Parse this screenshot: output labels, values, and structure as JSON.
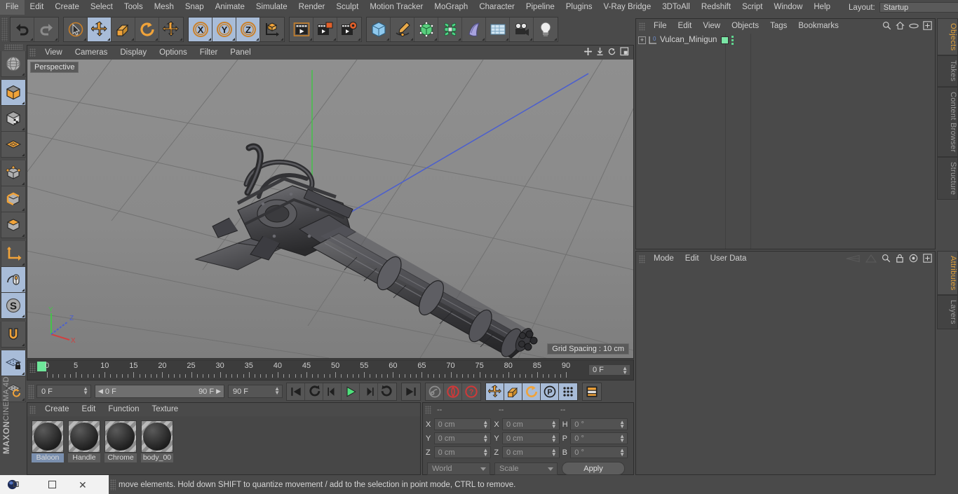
{
  "app": {
    "name": "CINEMA 4D",
    "brand_top": "MAXON",
    "brand_bottom": "CINEMA 4D"
  },
  "menubar": {
    "items": [
      "File",
      "Edit",
      "Create",
      "Select",
      "Tools",
      "Mesh",
      "Snap",
      "Animate",
      "Simulate",
      "Render",
      "Sculpt",
      "Motion Tracker",
      "MoGraph",
      "Character",
      "Pipeline",
      "Plugins",
      "V-Ray Bridge",
      "3DToAll",
      "Redshift",
      "Script",
      "Window",
      "Help"
    ],
    "layout_label": "Layout:",
    "layout_value": "Startup",
    "search_icon": "search-icon"
  },
  "toolbar": {
    "groups": [
      {
        "name": "history",
        "buttons": [
          {
            "icon": "undo-icon",
            "label": "Undo",
            "active": false
          },
          {
            "icon": "redo-icon",
            "label": "Redo",
            "active": false
          }
        ]
      },
      {
        "name": "tools",
        "buttons": [
          {
            "icon": "live-selection-icon",
            "label": "Live Selection",
            "active": false
          },
          {
            "icon": "move-icon",
            "label": "Move",
            "active": true
          },
          {
            "icon": "scale-icon",
            "label": "Scale",
            "active": false
          },
          {
            "icon": "rotate-icon",
            "label": "Rotate",
            "active": false
          },
          {
            "icon": "move-alt-icon",
            "label": "Move Alt",
            "active": false
          }
        ]
      },
      {
        "name": "axis-locks",
        "buttons": [
          {
            "icon": "axis-x-icon",
            "label": "X Axis",
            "active": true
          },
          {
            "icon": "axis-y-icon",
            "label": "Y Axis",
            "active": true
          },
          {
            "icon": "axis-z-icon",
            "label": "Z Axis",
            "active": true
          },
          {
            "icon": "world-coordinates-icon",
            "label": "World / Object Coordinates",
            "active": false
          }
        ]
      },
      {
        "name": "render",
        "buttons": [
          {
            "icon": "render-view-icon",
            "label": "Render View",
            "active": false
          },
          {
            "icon": "render-picture-viewer-icon",
            "label": "Render to Picture Viewer",
            "active": false
          },
          {
            "icon": "render-settings-icon",
            "label": "Edit Render Settings",
            "active": false
          }
        ]
      },
      {
        "name": "objects",
        "buttons": [
          {
            "icon": "cube-primitive-icon",
            "label": "Add Cube Object",
            "active": false
          },
          {
            "icon": "spline-pen-icon",
            "label": "Add Spline Object",
            "active": false
          },
          {
            "icon": "generator-icon",
            "label": "Add Generator Object",
            "active": false
          },
          {
            "icon": "mograph-icon",
            "label": "Add MoGraph Object",
            "active": false
          },
          {
            "icon": "deformer-icon",
            "label": "Add Bend Object",
            "active": false
          },
          {
            "icon": "scene-floor-icon",
            "label": "Add Environment Object",
            "active": false
          },
          {
            "icon": "camera-icon",
            "label": "Add Camera Object",
            "active": false
          },
          {
            "icon": "light-icon",
            "label": "Add Light Object",
            "active": false
          }
        ]
      }
    ]
  },
  "left_toolbar": {
    "buttons": [
      {
        "icon": "texture-axis-icon",
        "label": "Texture Axis",
        "active": false,
        "sep": true
      },
      {
        "icon": "model-mode-icon",
        "label": "Model Mode",
        "active": true
      },
      {
        "icon": "texture-mode-icon",
        "label": "Texture Mode",
        "active": false
      },
      {
        "icon": "workplane-mode-icon",
        "label": "Workplane Mode",
        "active": false,
        "sep": true
      },
      {
        "icon": "points-mode-icon",
        "label": "Points Mode",
        "active": false
      },
      {
        "icon": "edges-mode-icon",
        "label": "Edges Mode",
        "active": false
      },
      {
        "icon": "polygons-mode-icon",
        "label": "Polygons Mode",
        "active": false,
        "sep": true
      },
      {
        "icon": "enable-axis-icon",
        "label": "Enable Axis Modification",
        "active": false
      },
      {
        "icon": "viewport-solo-icon",
        "label": "Viewport Solo Single",
        "active": true
      },
      {
        "icon": "soft-selection-icon",
        "label": "Soft Selection",
        "active": true,
        "sep": true
      },
      {
        "icon": "snap-magnet-icon",
        "label": "Enable Snapping",
        "active": false,
        "sep": true
      },
      {
        "icon": "workplane-lock-icon",
        "label": "Lock Workplane",
        "active": true
      },
      {
        "icon": "workplane-reset-icon",
        "label": "Planar Workplane Mode",
        "active": false
      }
    ]
  },
  "viewport": {
    "menu": [
      "View",
      "Cameras",
      "Display",
      "Options",
      "Filter",
      "Panel"
    ],
    "view_tag": "Perspective",
    "grid_spacing": "Grid Spacing : 10 cm",
    "axis_labels": {
      "x": "X",
      "y": "Y",
      "z": "Z"
    },
    "corner_icons": [
      "pan-icon",
      "dolly-icon",
      "rotate-view-icon",
      "maximize-view-icon"
    ]
  },
  "timeline": {
    "ticks": [
      0,
      5,
      10,
      15,
      20,
      25,
      30,
      35,
      40,
      45,
      50,
      55,
      60,
      65,
      70,
      75,
      80,
      85,
      90
    ],
    "current_frame_field": "0 F",
    "playhead_frame": 0
  },
  "transport": {
    "current_frame": "0 F",
    "range_start": "0 F",
    "range_end": "90 F",
    "max_frame": "90 F",
    "buttons": [
      {
        "icon": "go-to-start-icon",
        "label": "Go to Start",
        "active": false
      },
      {
        "icon": "step-back-key-icon",
        "label": "Go to Previous Key",
        "active": false
      },
      {
        "icon": "step-back-frame-icon",
        "label": "Go to Previous Frame",
        "active": false
      },
      {
        "icon": "play-icon",
        "label": "Play Forwards",
        "active": false
      },
      {
        "icon": "step-forward-frame-icon",
        "label": "Go to Next Frame",
        "active": false
      },
      {
        "icon": "step-forward-key-icon",
        "label": "Go to Next Key",
        "active": false
      },
      {
        "icon": "go-to-end-icon",
        "label": "Go to End",
        "active": false
      },
      {
        "icon": "record-active-objects-icon",
        "label": "Record Active Objects",
        "active": false
      },
      {
        "icon": "autokeying-icon",
        "label": "Autokeying",
        "active": false
      },
      {
        "icon": "keyframe-selection-icon",
        "label": "Keyframe Selection",
        "active": false
      },
      {
        "icon": "key-position-icon",
        "label": "Position",
        "active": true
      },
      {
        "icon": "key-scale-icon",
        "label": "Scale",
        "active": true
      },
      {
        "icon": "key-rotation-icon",
        "label": "Rotation",
        "active": true
      },
      {
        "icon": "key-parameter-icon",
        "label": "Parameter",
        "active": true
      },
      {
        "icon": "key-pla-icon",
        "label": "Point Level Animation",
        "active": true
      },
      {
        "icon": "timeline-icon",
        "label": "Timeline",
        "active": false
      }
    ]
  },
  "material_manager": {
    "menu": [
      "Create",
      "Edit",
      "Function",
      "Texture"
    ],
    "materials": [
      {
        "name": "Baloon",
        "selected": true
      },
      {
        "name": "Handle",
        "selected": false
      },
      {
        "name": "Chrome",
        "selected": false
      },
      {
        "name": "body_00",
        "selected": false
      }
    ]
  },
  "coordinates": {
    "headers": [
      "--",
      "--",
      "--"
    ],
    "rows": [
      {
        "pos_label": "X",
        "pos_value": "0 cm",
        "size_label": "X",
        "size_value": "0 cm",
        "rot_label": "H",
        "rot_value": "0 °"
      },
      {
        "pos_label": "Y",
        "pos_value": "0 cm",
        "size_label": "Y",
        "size_value": "0 cm",
        "rot_label": "P",
        "rot_value": "0 °"
      },
      {
        "pos_label": "Z",
        "pos_value": "0 cm",
        "size_label": "Z",
        "size_value": "0 cm",
        "rot_label": "B",
        "rot_value": "0 °"
      }
    ],
    "system": "World",
    "mode": "Scale",
    "apply_label": "Apply"
  },
  "object_manager": {
    "menu": [
      "File",
      "Edit",
      "View",
      "Objects",
      "Tags",
      "Bookmarks"
    ],
    "icons": [
      "search-icon",
      "home-icon",
      "link-icon",
      "new-layer-icon"
    ],
    "objects": [
      {
        "name": "Vulcan_Minigun",
        "level": 0,
        "expanded": false,
        "layer_number": "0",
        "tag_color": "#7ae6a6"
      }
    ]
  },
  "attribute_manager": {
    "menu": [
      "Mode",
      "Edit",
      "User Data"
    ],
    "icons": [
      "history-back-icon",
      "history-forward-icon",
      "search-icon",
      "lock-icon",
      "target-icon",
      "new-tab-icon"
    ]
  },
  "right_tabs_top": [
    {
      "label": "Objects",
      "active": true
    },
    {
      "label": "Takes",
      "active": false
    },
    {
      "label": "Content Browser",
      "active": false
    },
    {
      "label": "Structure",
      "active": false
    }
  ],
  "right_tabs_bottom": [
    {
      "label": "Attributes",
      "active": true
    },
    {
      "label": "Layers",
      "active": false
    }
  ],
  "statusbar": {
    "text": "move elements. Hold down SHIFT to quantize movement / add to the selection in point mode, CTRL to remove."
  },
  "taskbar": {
    "icons": [
      "app-icon",
      "restore-icon",
      "close-icon"
    ]
  },
  "colors": {
    "accent_orange": "#e2a33c",
    "active_blue": "#a8bcd8",
    "green_tag": "#7ae6a6",
    "panel_bg": "#4a4a4a",
    "viewport_bg": "#888888",
    "axis_x": "#d04040",
    "axis_y": "#45c24a",
    "axis_z": "#4a5ed0"
  }
}
